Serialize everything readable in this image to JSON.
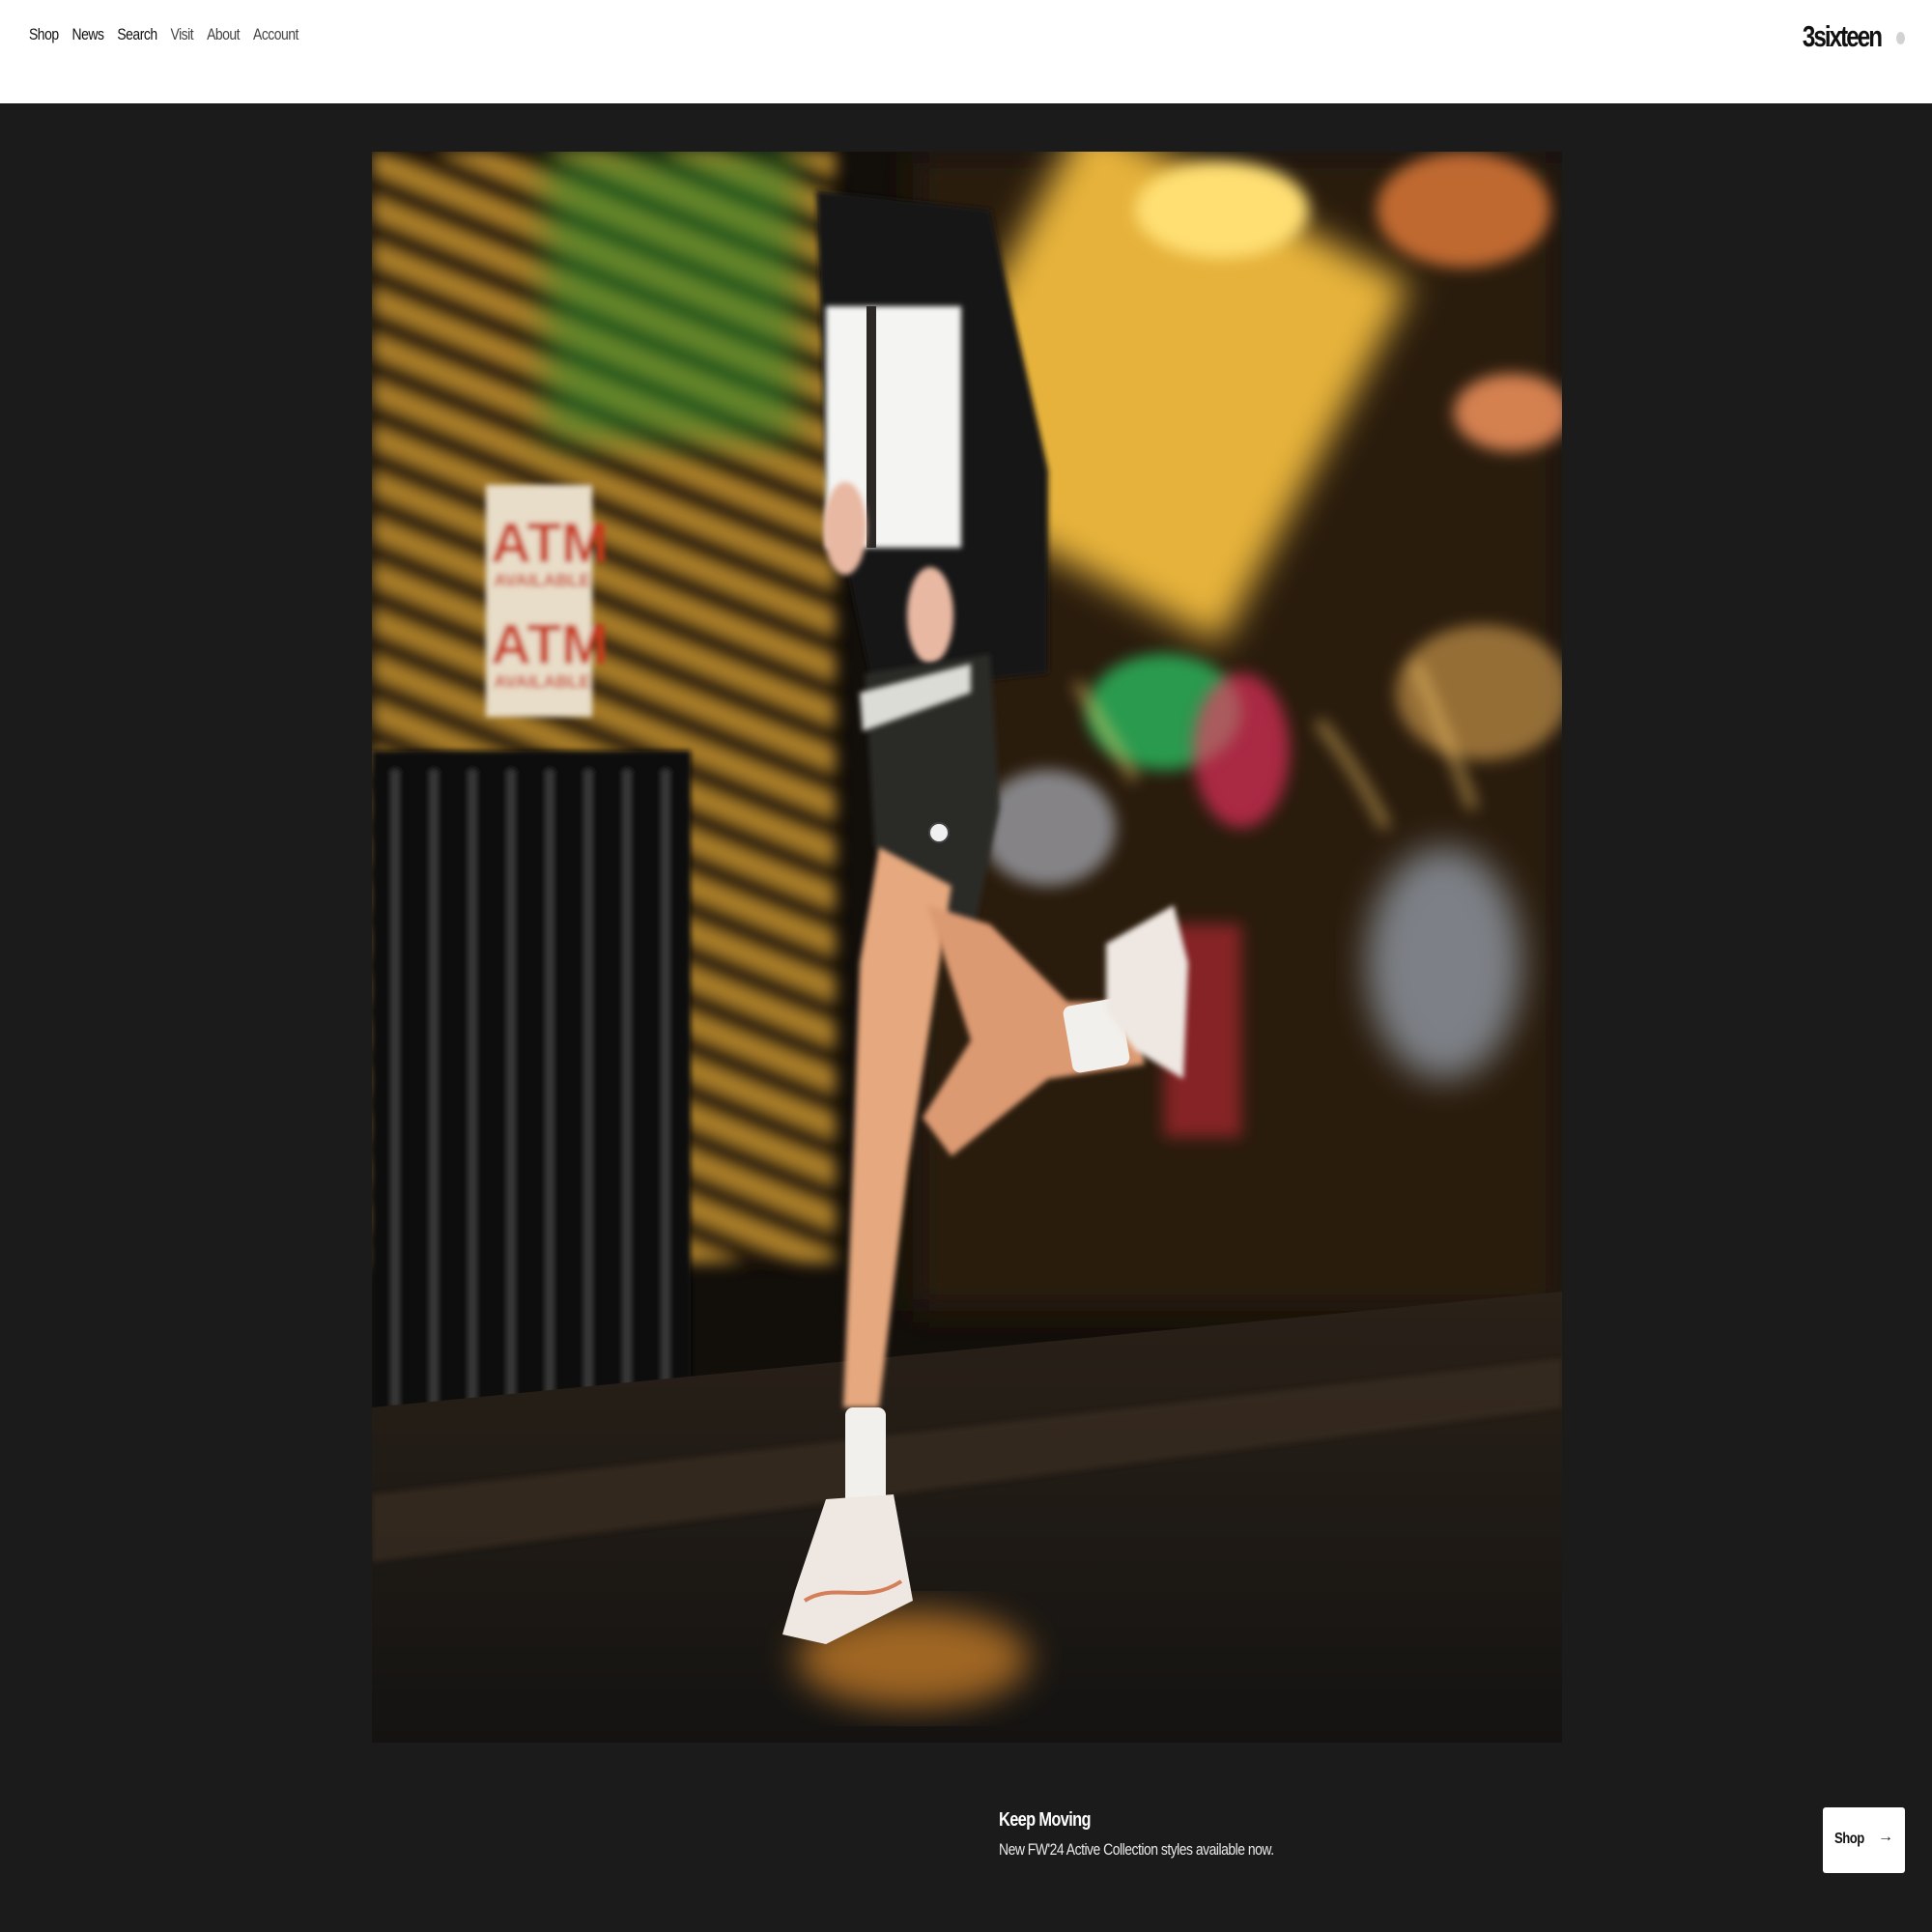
{
  "nav": {
    "items": [
      "Shop",
      "News",
      "Search",
      "Visit",
      "About",
      "Account"
    ]
  },
  "brand": {
    "logo_text": "3sixteen"
  },
  "hero": {
    "image_description_icon": "runner-photo",
    "sign_text_1": "ATM",
    "sign_text_2": "AVAILABLE",
    "sign_text_3": "ATM",
    "sign_text_4": "AVAILABLE"
  },
  "promo": {
    "title": "Keep Moving",
    "subtitle": "New FW'24 Active Collection styles available now.",
    "button_label": "Shop",
    "button_icon": "arrow-right-icon"
  },
  "colors": {
    "page_background": "#1b1b1c",
    "header_background": "#ffffff",
    "text_light": "#ffffff",
    "text_dark": "#111111"
  }
}
